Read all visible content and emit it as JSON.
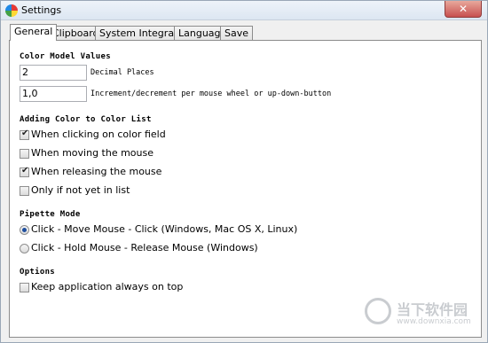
{
  "window": {
    "title": "Settings",
    "close_glyph": "✕"
  },
  "tabs": [
    {
      "label": "General",
      "active": true
    },
    {
      "label": "Clipboard",
      "active": false
    },
    {
      "label": "System Integration",
      "active": false
    },
    {
      "label": "Language",
      "active": false
    },
    {
      "label": "Save",
      "active": false
    }
  ],
  "color_model": {
    "title": "Color Model Values",
    "decimal_places": {
      "value": "2",
      "label": "Decimal Places"
    },
    "increment": {
      "value": "1,0",
      "label": "Increment/decrement per mouse wheel or up-down-button"
    }
  },
  "adding_color": {
    "title": "Adding Color to Color List",
    "options": [
      {
        "label": "When clicking on color field",
        "checked": true
      },
      {
        "label": "When moving the mouse",
        "checked": false
      },
      {
        "label": "When releasing the mouse",
        "checked": true
      },
      {
        "label": "Only if not yet in list",
        "checked": false
      }
    ]
  },
  "pipette_mode": {
    "title": "Pipette Mode",
    "options": [
      {
        "label": "Click - Move Mouse - Click (Windows, Mac OS X, Linux)",
        "selected": true
      },
      {
        "label": "Click - Hold Mouse - Release Mouse (Windows)",
        "selected": false
      }
    ]
  },
  "options": {
    "title": "Options",
    "always_on_top": {
      "label": "Keep application always on top",
      "checked": false
    }
  },
  "watermark": {
    "text": "当下软件园",
    "url": "www.downxia.com"
  }
}
